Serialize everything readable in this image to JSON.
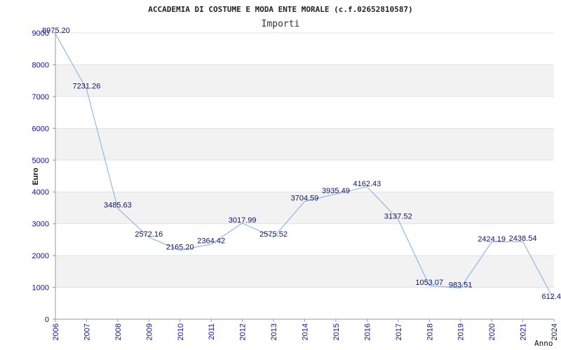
{
  "chart_data": {
    "type": "line",
    "title": "ACCADEMIA DI COSTUME E MODA ENTE MORALE (c.f.02652810587)",
    "subtitle": "Importi",
    "xlabel": "Anno",
    "ylabel": "Euro",
    "ylim": [
      0,
      9000
    ],
    "yticks": [
      0,
      1000,
      2000,
      3000,
      4000,
      5000,
      6000,
      7000,
      8000,
      9000
    ],
    "x": [
      "2006",
      "2007",
      "2008",
      "2009",
      "2010",
      "2011",
      "2012",
      "2013",
      "2014",
      "2015",
      "2016",
      "2017",
      "2018",
      "2019",
      "2020",
      "2021",
      "2024"
    ],
    "series": [
      {
        "values": [
          8975.2,
          7231.26,
          3485.63,
          2572.16,
          2165.2,
          2364.42,
          3017.99,
          2575.52,
          3704.59,
          3935.49,
          4162.43,
          3137.52,
          1053.07,
          983.51,
          2424.19,
          2438.54,
          612.4
        ],
        "labels": [
          "8975.20",
          "7231.26",
          "3485.63",
          "2572.16",
          "2165.20",
          "2364.42",
          "3017.99",
          "2575.52",
          "3704.59",
          "3935.49",
          "4162.43",
          "3137.52",
          "1053.07",
          "983.51",
          "2424.19",
          "2438.54",
          "612.4"
        ]
      }
    ],
    "grid": true,
    "band_colors": [
      "#f2f2f2",
      "#ffffff"
    ],
    "line_color": "#7aaee8",
    "tick_color": "#1010a0"
  }
}
